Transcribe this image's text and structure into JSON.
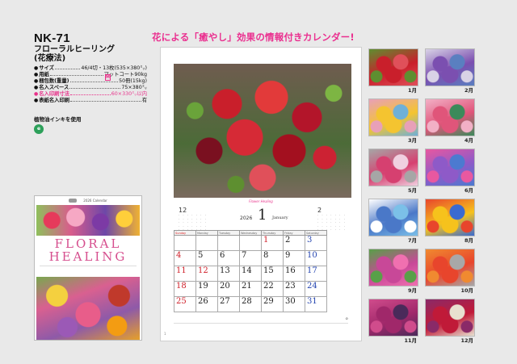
{
  "product": {
    "code": "NK-71",
    "name_line1": "フローラルヒーリング",
    "name_line2": "(花療法)"
  },
  "specs": [
    {
      "label": "サイズ",
      "value": "46/4切・13枚(535×380㍉)",
      "pink": false
    },
    {
      "label": "用紙",
      "value": "マットコート90kg",
      "pink": false
    },
    {
      "label": "梱包数(重量)",
      "value": "50冊(15kg)",
      "pink": false
    },
    {
      "label": "名入スペース",
      "value": "75×380㍉",
      "pink": false
    },
    {
      "label": "名入印刷寸法",
      "value": "60×330㍉以内",
      "pink": true
    },
    {
      "label": "表紙名入印刷",
      "value": "有",
      "pink": false
    }
  ],
  "badge": "M",
  "ink_text": "植物油インキを使用",
  "ink_logo": "e",
  "headline": "花による「癒やし」効果の情報付きカレンダー!",
  "cover": {
    "top_text": "2026 Calendar",
    "title_line1": "FLORAL",
    "title_line2": "HEALING"
  },
  "calendar": {
    "year": "2026",
    "month_num": "1",
    "month_en": "January",
    "caption": "Flower Healing",
    "prev_month": "12",
    "next_month": "2",
    "weekdays": [
      "Sunday",
      "Monday",
      "Tuesday",
      "Wednesday",
      "Thursday",
      "Friday",
      "Saturday"
    ],
    "weeks": [
      [
        "",
        "",
        "",
        "",
        "1",
        "2",
        "3"
      ],
      [
        "4",
        "5",
        "6",
        "7",
        "8",
        "9",
        "10"
      ],
      [
        "11",
        "12",
        "13",
        "14",
        "15",
        "16",
        "17"
      ],
      [
        "18",
        "19",
        "20",
        "21",
        "22",
        "23",
        "24"
      ],
      [
        "25",
        "26",
        "27",
        "28",
        "29",
        "30",
        "31"
      ]
    ],
    "holidays": [
      "1",
      "12"
    ],
    "page_num": "1"
  },
  "colors": {
    "accent_pink": "#ea2f8f",
    "holiday_red": "#d0202a",
    "saturday_blue": "#2444b0"
  },
  "months": [
    {
      "label": "1月",
      "c1": "#c91f2b",
      "c2": "#5e8f30",
      "c3": "#e0505a"
    },
    {
      "label": "2月",
      "c1": "#7b4fb0",
      "c2": "#d9d2e6",
      "c3": "#5a7fc0"
    },
    {
      "label": "3月",
      "c1": "#f4c430",
      "c2": "#e8a0b8",
      "c3": "#6fb0d8"
    },
    {
      "label": "4月",
      "c1": "#e0557a",
      "c2": "#f2b0c6",
      "c3": "#3b8a5a"
    },
    {
      "label": "5月",
      "c1": "#d64070",
      "c2": "#a6a6a6",
      "c3": "#f0d0e0"
    },
    {
      "label": "6月",
      "c1": "#8e5ac8",
      "c2": "#e858a0",
      "c3": "#4c7ad0"
    },
    {
      "label": "7月",
      "c1": "#4a78c8",
      "c2": "#ffffff",
      "c3": "#7bc0e8"
    },
    {
      "label": "8月",
      "c1": "#f6c21c",
      "c2": "#e8452c",
      "c3": "#3a6ad0"
    },
    {
      "label": "9月",
      "c1": "#c84898",
      "c2": "#58a048",
      "c3": "#f070b0"
    },
    {
      "label": "10月",
      "c1": "#e8452c",
      "c2": "#f08a30",
      "c3": "#a8a8a8"
    },
    {
      "label": "11月",
      "c1": "#a0286a",
      "c2": "#d04c8c",
      "c3": "#4a2a5a"
    },
    {
      "label": "12月",
      "c1": "#c01a38",
      "c2": "#8a2a68",
      "c3": "#e8e0d0"
    }
  ]
}
